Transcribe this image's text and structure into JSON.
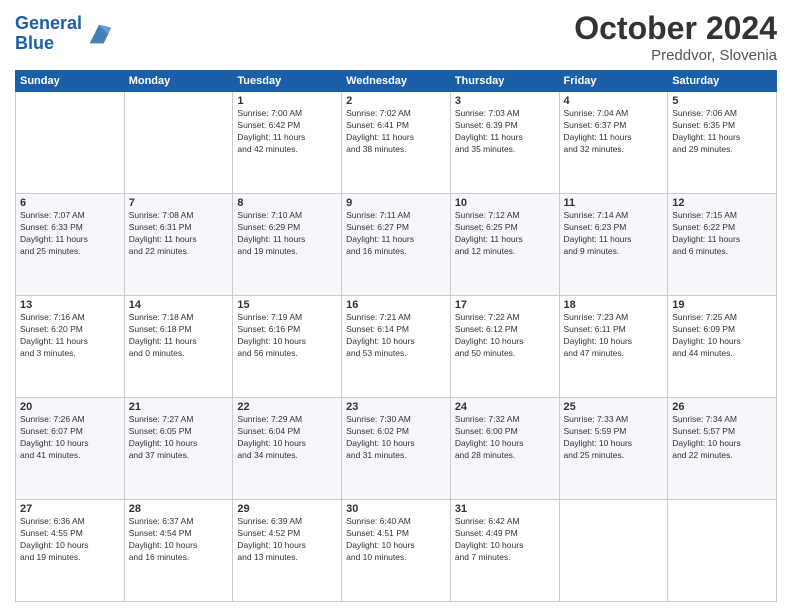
{
  "logo": {
    "line1": "General",
    "line2": "Blue"
  },
  "header": {
    "month": "October 2024",
    "location": "Preddvor, Slovenia"
  },
  "weekdays": [
    "Sunday",
    "Monday",
    "Tuesday",
    "Wednesday",
    "Thursday",
    "Friday",
    "Saturday"
  ],
  "weeks": [
    [
      {
        "day": "",
        "info": ""
      },
      {
        "day": "",
        "info": ""
      },
      {
        "day": "1",
        "info": "Sunrise: 7:00 AM\nSunset: 6:42 PM\nDaylight: 11 hours\nand 42 minutes."
      },
      {
        "day": "2",
        "info": "Sunrise: 7:02 AM\nSunset: 6:41 PM\nDaylight: 11 hours\nand 38 minutes."
      },
      {
        "day": "3",
        "info": "Sunrise: 7:03 AM\nSunset: 6:39 PM\nDaylight: 11 hours\nand 35 minutes."
      },
      {
        "day": "4",
        "info": "Sunrise: 7:04 AM\nSunset: 6:37 PM\nDaylight: 11 hours\nand 32 minutes."
      },
      {
        "day": "5",
        "info": "Sunrise: 7:06 AM\nSunset: 6:35 PM\nDaylight: 11 hours\nand 29 minutes."
      }
    ],
    [
      {
        "day": "6",
        "info": "Sunrise: 7:07 AM\nSunset: 6:33 PM\nDaylight: 11 hours\nand 25 minutes."
      },
      {
        "day": "7",
        "info": "Sunrise: 7:08 AM\nSunset: 6:31 PM\nDaylight: 11 hours\nand 22 minutes."
      },
      {
        "day": "8",
        "info": "Sunrise: 7:10 AM\nSunset: 6:29 PM\nDaylight: 11 hours\nand 19 minutes."
      },
      {
        "day": "9",
        "info": "Sunrise: 7:11 AM\nSunset: 6:27 PM\nDaylight: 11 hours\nand 16 minutes."
      },
      {
        "day": "10",
        "info": "Sunrise: 7:12 AM\nSunset: 6:25 PM\nDaylight: 11 hours\nand 12 minutes."
      },
      {
        "day": "11",
        "info": "Sunrise: 7:14 AM\nSunset: 6:23 PM\nDaylight: 11 hours\nand 9 minutes."
      },
      {
        "day": "12",
        "info": "Sunrise: 7:15 AM\nSunset: 6:22 PM\nDaylight: 11 hours\nand 6 minutes."
      }
    ],
    [
      {
        "day": "13",
        "info": "Sunrise: 7:16 AM\nSunset: 6:20 PM\nDaylight: 11 hours\nand 3 minutes."
      },
      {
        "day": "14",
        "info": "Sunrise: 7:18 AM\nSunset: 6:18 PM\nDaylight: 11 hours\nand 0 minutes."
      },
      {
        "day": "15",
        "info": "Sunrise: 7:19 AM\nSunset: 6:16 PM\nDaylight: 10 hours\nand 56 minutes."
      },
      {
        "day": "16",
        "info": "Sunrise: 7:21 AM\nSunset: 6:14 PM\nDaylight: 10 hours\nand 53 minutes."
      },
      {
        "day": "17",
        "info": "Sunrise: 7:22 AM\nSunset: 6:12 PM\nDaylight: 10 hours\nand 50 minutes."
      },
      {
        "day": "18",
        "info": "Sunrise: 7:23 AM\nSunset: 6:11 PM\nDaylight: 10 hours\nand 47 minutes."
      },
      {
        "day": "19",
        "info": "Sunrise: 7:25 AM\nSunset: 6:09 PM\nDaylight: 10 hours\nand 44 minutes."
      }
    ],
    [
      {
        "day": "20",
        "info": "Sunrise: 7:26 AM\nSunset: 6:07 PM\nDaylight: 10 hours\nand 41 minutes."
      },
      {
        "day": "21",
        "info": "Sunrise: 7:27 AM\nSunset: 6:05 PM\nDaylight: 10 hours\nand 37 minutes."
      },
      {
        "day": "22",
        "info": "Sunrise: 7:29 AM\nSunset: 6:04 PM\nDaylight: 10 hours\nand 34 minutes."
      },
      {
        "day": "23",
        "info": "Sunrise: 7:30 AM\nSunset: 6:02 PM\nDaylight: 10 hours\nand 31 minutes."
      },
      {
        "day": "24",
        "info": "Sunrise: 7:32 AM\nSunset: 6:00 PM\nDaylight: 10 hours\nand 28 minutes."
      },
      {
        "day": "25",
        "info": "Sunrise: 7:33 AM\nSunset: 5:59 PM\nDaylight: 10 hours\nand 25 minutes."
      },
      {
        "day": "26",
        "info": "Sunrise: 7:34 AM\nSunset: 5:57 PM\nDaylight: 10 hours\nand 22 minutes."
      }
    ],
    [
      {
        "day": "27",
        "info": "Sunrise: 6:36 AM\nSunset: 4:55 PM\nDaylight: 10 hours\nand 19 minutes."
      },
      {
        "day": "28",
        "info": "Sunrise: 6:37 AM\nSunset: 4:54 PM\nDaylight: 10 hours\nand 16 minutes."
      },
      {
        "day": "29",
        "info": "Sunrise: 6:39 AM\nSunset: 4:52 PM\nDaylight: 10 hours\nand 13 minutes."
      },
      {
        "day": "30",
        "info": "Sunrise: 6:40 AM\nSunset: 4:51 PM\nDaylight: 10 hours\nand 10 minutes."
      },
      {
        "day": "31",
        "info": "Sunrise: 6:42 AM\nSunset: 4:49 PM\nDaylight: 10 hours\nand 7 minutes."
      },
      {
        "day": "",
        "info": ""
      },
      {
        "day": "",
        "info": ""
      }
    ]
  ]
}
